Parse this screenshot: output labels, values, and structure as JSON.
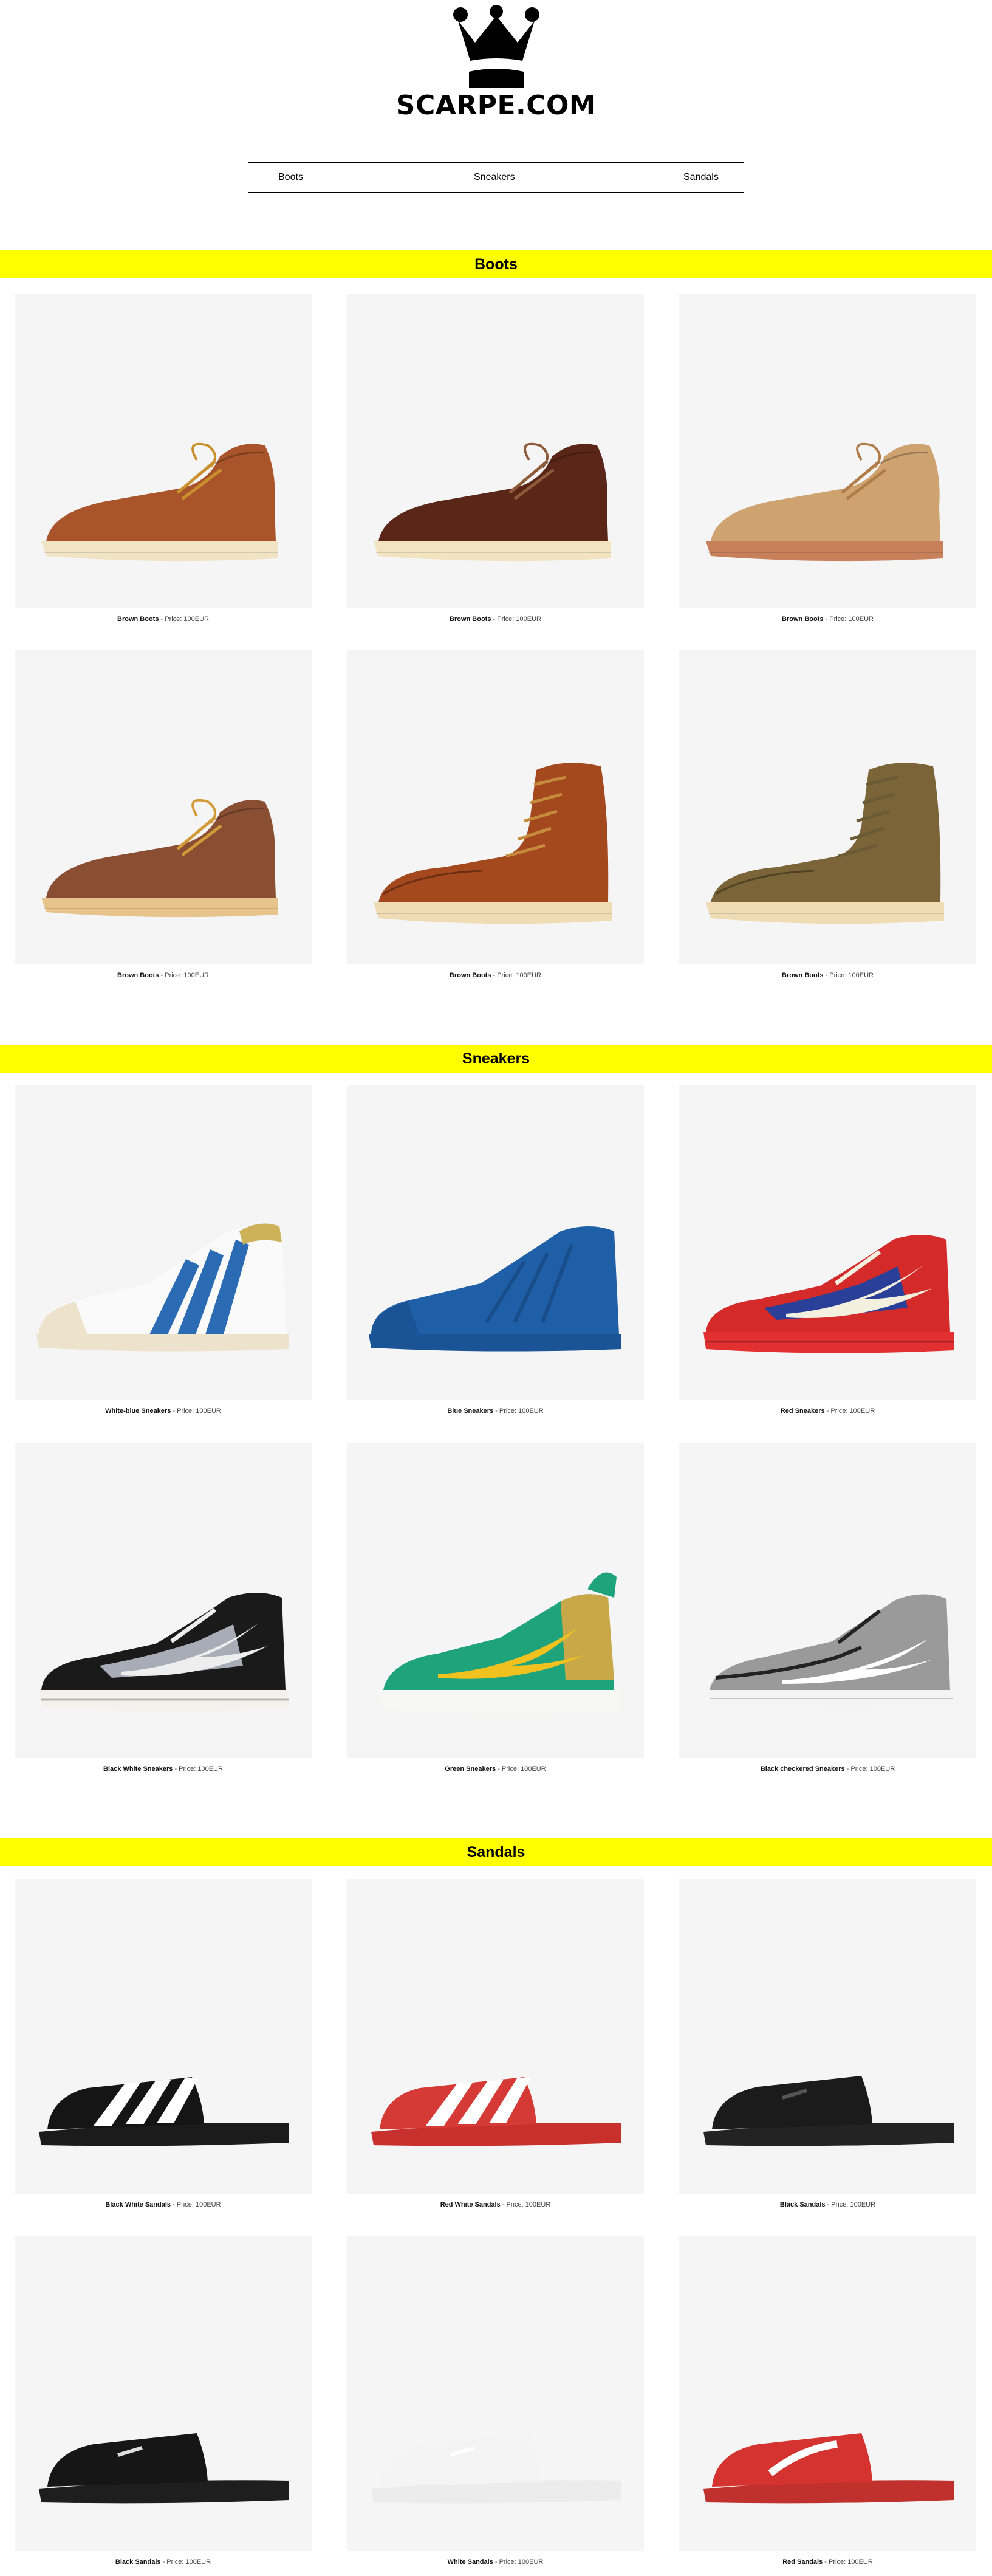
{
  "brand": {
    "name": "SCARPE.COM",
    "logo_icon": "crown-icon"
  },
  "nav": {
    "items": [
      {
        "label": "Boots"
      },
      {
        "label": "Sneakers"
      },
      {
        "label": "Sandals"
      }
    ]
  },
  "price_separator": " - ",
  "sections": [
    {
      "title": "Boots",
      "products": [
        {
          "name": "Brown Boots",
          "price": "Price: 100EUR",
          "kind": "chukka",
          "upper": "#a9542a",
          "sole": "#f0e4c4",
          "lace": "#c9902c"
        },
        {
          "name": "Brown Boots",
          "price": "Price: 100EUR",
          "kind": "chukka",
          "upper": "#5a2618",
          "sole": "#f2e4c0",
          "lace": "#8d5a3a"
        },
        {
          "name": "Brown Boots",
          "price": "Price: 100EUR",
          "kind": "chukka-suede",
          "upper": "#cea370",
          "sole": "#c7805a",
          "lace": "#b07c48"
        },
        {
          "name": "Brown Boots",
          "price": "Price: 100EUR",
          "kind": "chukka",
          "upper": "#8a4f33",
          "sole": "#e6c48c",
          "lace": "#d39a3a"
        },
        {
          "name": "Brown Boots",
          "price": "Price: 100EUR",
          "kind": "moc",
          "upper": "#a4481e",
          "sole": "#f0dcb4",
          "lace": "#c58a3c"
        },
        {
          "name": "Brown Boots",
          "price": "Price: 100EUR",
          "kind": "moc",
          "upper": "#7a6438",
          "sole": "#f0dcb4",
          "lace": "#6b5a36"
        }
      ]
    },
    {
      "title": "Sneakers",
      "products": [
        {
          "name": "White-blue Sneakers",
          "price": "Price: 100EUR",
          "kind": "superstar",
          "upper": "#fafafa",
          "sole": "#ede3cc",
          "accent": "#2a6bb3"
        },
        {
          "name": "Blue Sneakers",
          "price": "Price: 100EUR",
          "kind": "superstar-mono",
          "upper": "#1f5fa8",
          "sole": "#1b5496",
          "accent": "#2a6bb3"
        },
        {
          "name": "Red Sneakers",
          "price": "Price: 100EUR",
          "kind": "af1",
          "upper": "#d42a2a",
          "sole": "#e23030",
          "accent": "#f4f0e0",
          "panel": "#2a3f98"
        },
        {
          "name": "Black White Sneakers",
          "price": "Price: 100EUR",
          "kind": "af1",
          "upper": "#1a1a1a",
          "sole": "#f4f2ec",
          "accent": "#eeeeee",
          "panel": "#a8acb6"
        },
        {
          "name": "Green Sneakers",
          "price": "Price: 100EUR",
          "kind": "runner",
          "upper": "#1fa37a",
          "sole": "#f7f7f3",
          "accent": "#f1c21f",
          "panel": "#c9a84a"
        },
        {
          "name": "Black checkered Sneakers",
          "price": "Price: 100EUR",
          "kind": "knit",
          "upper": "#9a9a9a",
          "sole": "#f4f4f4",
          "accent": "#ffffff",
          "panel": "#222222"
        }
      ]
    },
    {
      "title": "Sandals",
      "products": [
        {
          "name": "Black White Sandals",
          "price": "Price: 100EUR",
          "kind": "stripes",
          "upper": "#151515",
          "sole": "#1b1b1b",
          "accent": "#ffffff"
        },
        {
          "name": "Red White Sandals",
          "price": "Price: 100EUR",
          "kind": "stripes",
          "upper": "#d63a36",
          "sole": "#c7302d",
          "accent": "#ffffff"
        },
        {
          "name": "Black Sandals",
          "price": "Price: 100EUR",
          "kind": "slide",
          "upper": "#1b1b1b",
          "sole": "#232323",
          "accent": "#555555"
        },
        {
          "name": "Black Sandals",
          "price": "Price: 100EUR",
          "kind": "slide",
          "upper": "#161616",
          "sole": "#1e1e1e",
          "accent": "#dddddd"
        },
        {
          "name": "White Sandals",
          "price": "Price: 100EUR",
          "kind": "slide",
          "upper": "#f4f4f4",
          "sole": "#ececec",
          "accent": "#ffffff"
        },
        {
          "name": "Red Sandals",
          "price": "Price: 100EUR",
          "kind": "slide-logo",
          "upper": "#d4332f",
          "sole": "#c0302c",
          "accent": "#ffffff"
        }
      ]
    }
  ]
}
